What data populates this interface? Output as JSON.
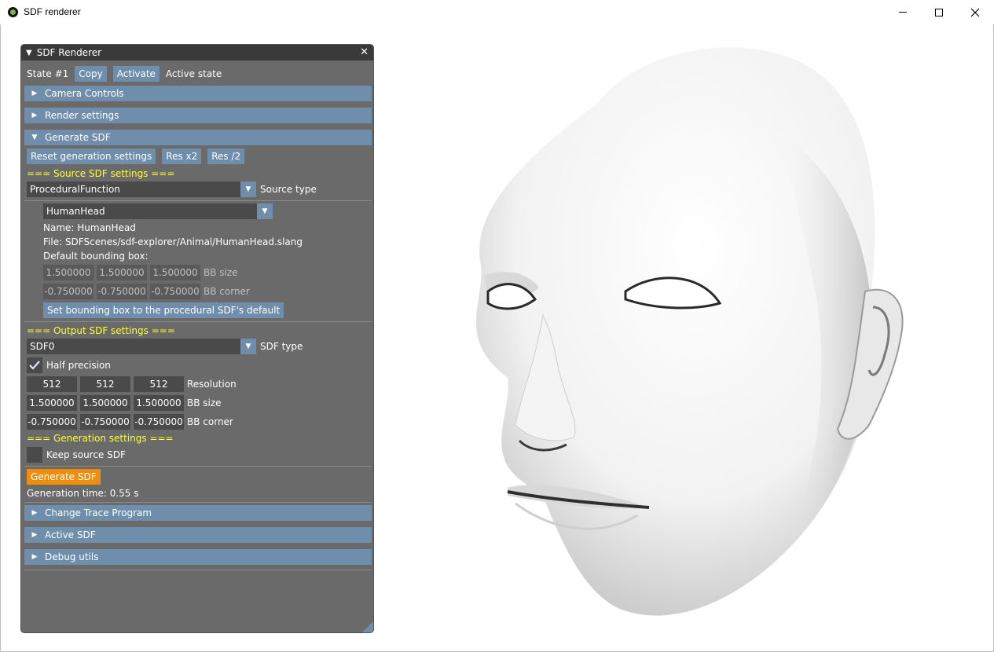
{
  "window": {
    "title": "SDF renderer"
  },
  "panel": {
    "title": "SDF Renderer",
    "state_label": "State #1",
    "copy_label": "Copy",
    "activate_label": "Activate",
    "active_state_label": "Active state",
    "headers": {
      "camera": "Camera Controls",
      "render": "Render settings",
      "generate": "Generate SDF",
      "trace": "Change Trace Program",
      "active_sdf": "Active SDF",
      "debug": "Debug utils"
    },
    "gen_buttons": {
      "reset": "Reset generation settings",
      "res_x2": "Res x2",
      "res_half": "Res /2"
    },
    "source": {
      "section_title": "=== Source SDF settings ===",
      "source_type_value": "ProceduralFunction",
      "source_type_label": "Source type",
      "function_value": "HumanHead",
      "name_line": "Name: HumanHead",
      "file_line": "File: SDFScenes/sdf-explorer/Animal/HumanHead.slang",
      "default_bb_label": "Default bounding box:",
      "bb_size": [
        "1.500000",
        "1.500000",
        "1.500000"
      ],
      "bb_size_label": "BB size",
      "bb_corner": [
        "-0.750000",
        "-0.750000",
        "-0.750000"
      ],
      "bb_corner_label": "BB corner",
      "set_bb_button": "Set bounding box to the procedural SDF's default"
    },
    "output": {
      "section_title": "=== Output SDF settings ===",
      "sdf_type_value": "SDF0",
      "sdf_type_label": "SDF type",
      "half_precision_label": "Half precision",
      "half_precision_checked": true,
      "resolution": [
        "512",
        "512",
        "512"
      ],
      "resolution_label": "Resolution",
      "bb_size": [
        "1.500000",
        "1.500000",
        "1.500000"
      ],
      "bb_size_label": "BB size",
      "bb_corner": [
        "-0.750000",
        "-0.750000",
        "-0.750000"
      ],
      "bb_corner_label": "BB corner"
    },
    "generation": {
      "section_title": "=== Generation settings ===",
      "keep_source_label": "Keep source SDF",
      "keep_source_checked": false,
      "generate_button": "Generate SDF",
      "time_line": "Generation time: 0.55 s"
    }
  },
  "colors": {
    "panel_bg": "#6a6a6a",
    "accent": "#6f8eab",
    "section_text": "#ffff33",
    "generate_button": "#ef8e0d"
  }
}
